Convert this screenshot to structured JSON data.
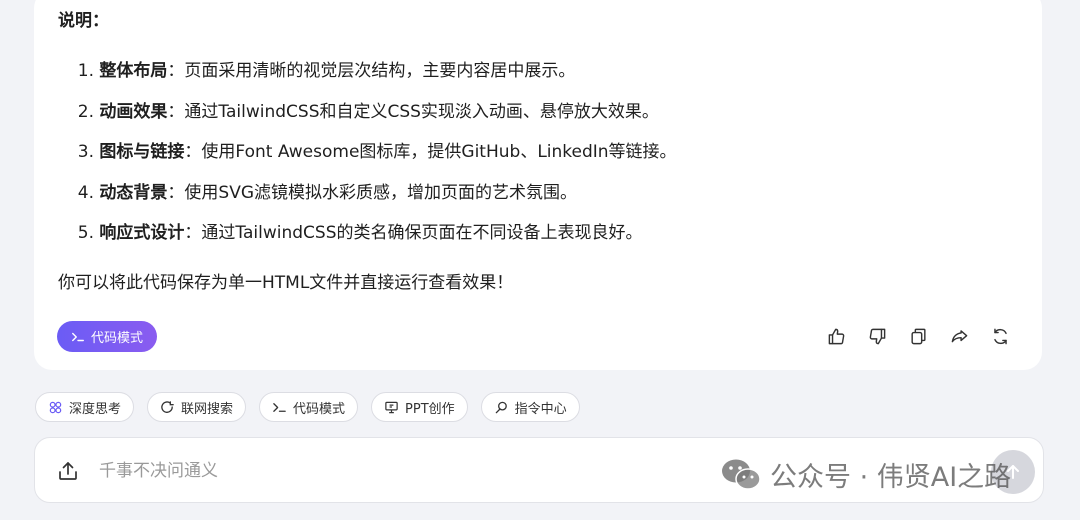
{
  "explanation": {
    "intro": "说明：",
    "points": [
      {
        "num": "1.",
        "title": "整体布局",
        "text": "：页面采用清晰的视觉层次结构，主要内容居中展示。"
      },
      {
        "num": "2.",
        "title": "动画效果",
        "text": "：通过TailwindCSS和自定义CSS实现淡入动画、悬停放大效果。"
      },
      {
        "num": "3.",
        "title": "图标与链接",
        "text": "：使用Font Awesome图标库，提供GitHub、LinkedIn等链接。"
      },
      {
        "num": "4.",
        "title": "动态背景",
        "text": "：使用SVG滤镜模拟水彩质感，增加页面的艺术氛围。"
      },
      {
        "num": "5.",
        "title": "响应式设计",
        "text": "：通过TailwindCSS的类名确保页面在不同设备上表现良好。"
      }
    ],
    "conclusion": "你可以将此代码保存为单一HTML文件并直接运行查看效果！"
  },
  "message": {
    "mode_tag": "代码模式",
    "actions": [
      "thumbs-up-icon",
      "thumbs-down-icon",
      "copy-icon",
      "share-icon",
      "regenerate-icon"
    ]
  },
  "chips": [
    {
      "label": "深度思考",
      "icon": "deep-think-icon"
    },
    {
      "label": "联网搜索",
      "icon": "web-search-icon"
    },
    {
      "label": "代码模式",
      "icon": "code-mode-icon"
    },
    {
      "label": "PPT创作",
      "icon": "ppt-icon"
    },
    {
      "label": "指令中心",
      "icon": "command-center-icon"
    }
  ],
  "composer": {
    "placeholder": "千事不决问通义"
  },
  "watermark": {
    "text": "公众号 · 伟贤AI之路"
  },
  "colors": {
    "accent": "#6b5cf5",
    "background": "#f2f3f7"
  }
}
